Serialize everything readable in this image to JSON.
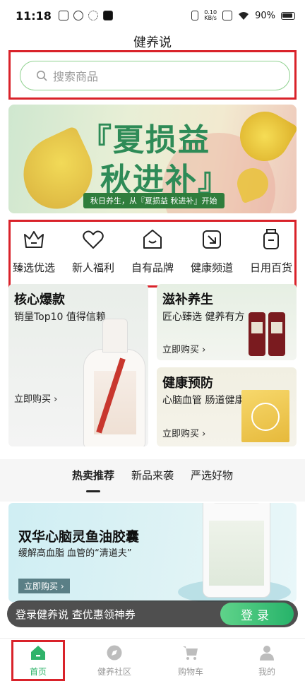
{
  "status_bar": {
    "time": "11:18",
    "netspeed_value": "0.10",
    "netspeed_unit": "KB/s",
    "battery": "90%"
  },
  "app": {
    "title": "健养说"
  },
  "search": {
    "placeholder": "搜索商品"
  },
  "banner": {
    "line1": "『夏损益",
    "line2": "秋进补』",
    "subtitle": "秋日养生，从『夏损益 秋进补』开始"
  },
  "categories": [
    {
      "label": "臻选优选",
      "icon": "crown-icon"
    },
    {
      "label": "新人福利",
      "icon": "heart-icon"
    },
    {
      "label": "自有品牌",
      "icon": "home-smile-icon"
    },
    {
      "label": "健康频道",
      "icon": "arrow-box-icon"
    },
    {
      "label": "日用百货",
      "icon": "jar-icon"
    }
  ],
  "cards": {
    "core": {
      "title": "核心爆款",
      "subtitle": "销量Top10 值得信赖",
      "cta": "立即购买 ›"
    },
    "nourish": {
      "title": "滋补养生",
      "subtitle": "匠心臻选 健养有方",
      "cta": "立即购买 ›"
    },
    "health": {
      "title": "健康预防",
      "subtitle": "心脑血管 肠道健康",
      "cta": "立即购买 ›"
    }
  },
  "tabs": [
    {
      "label": "热卖推荐",
      "active": true
    },
    {
      "label": "新品来袭",
      "active": false
    },
    {
      "label": "严选好物",
      "active": false
    }
  ],
  "promo": {
    "title": "双华心脑灵鱼油胶囊",
    "subtitle": "缓解高血脂 血管的“清道夫”",
    "cta": "立即购买 ›"
  },
  "login_bar": {
    "text": "登录健养说 查优惠领神券",
    "button": "登录"
  },
  "bottom_nav": [
    {
      "label": "首页",
      "icon": "home-icon",
      "active": true
    },
    {
      "label": "健养社区",
      "icon": "compass-icon",
      "active": false
    },
    {
      "label": "购物车",
      "icon": "cart-icon",
      "active": false
    },
    {
      "label": "我的",
      "icon": "user-icon",
      "active": false
    }
  ],
  "colors": {
    "accent": "#2fb36a",
    "highlight": "#d9222a"
  }
}
